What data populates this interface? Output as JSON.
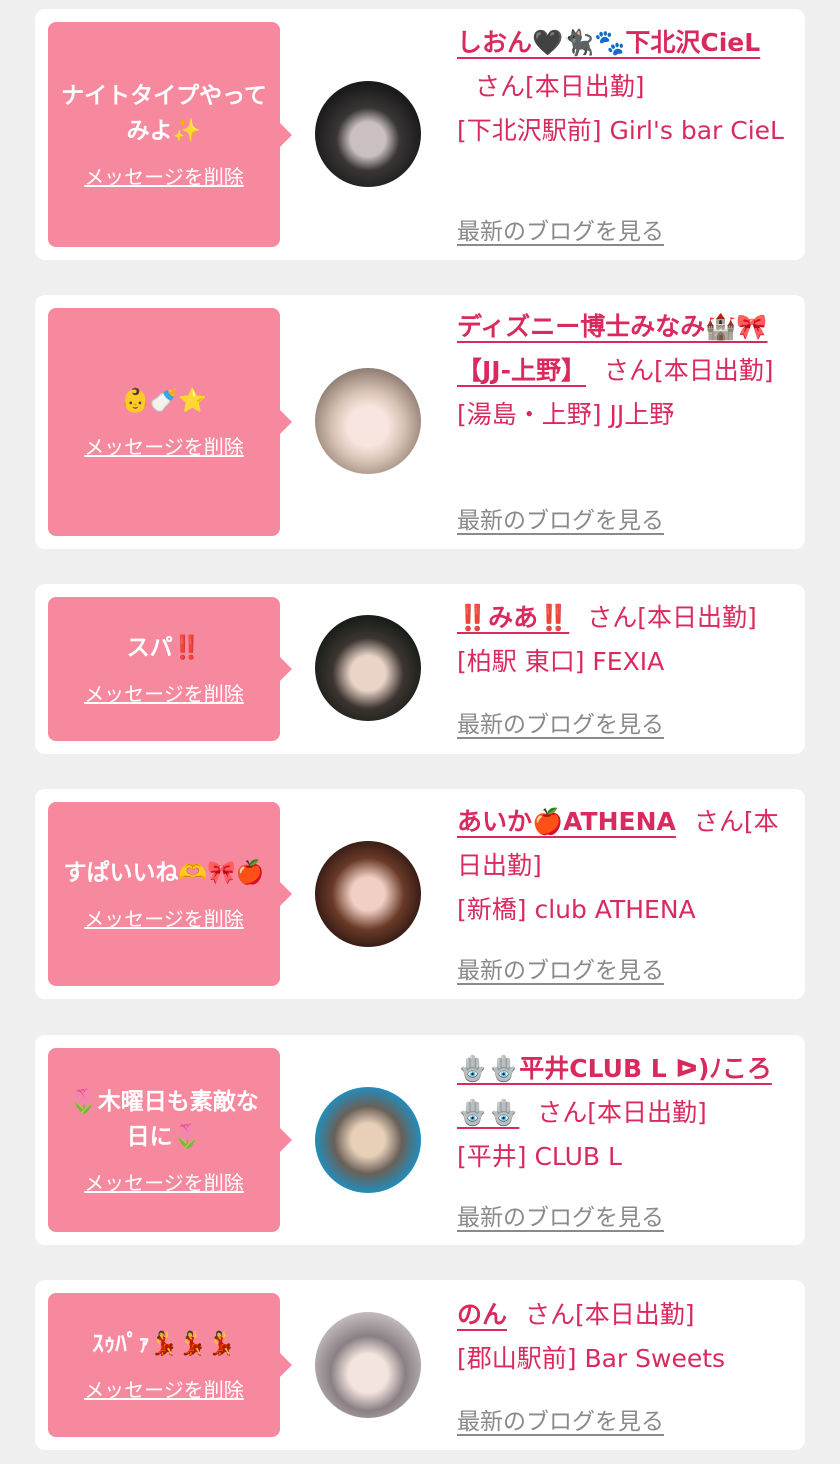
{
  "labels": {
    "delete": "メッセージを削除",
    "blog": "最新のブログを見る"
  },
  "items": [
    {
      "message": "ナイトタイプやってみよ✨",
      "name": "しおん🖤🐈‍⬛🐾下北沢CieL",
      "suffix": "さん[本日出勤]",
      "shop": "[下北沢駅前] Girl's bar CieL",
      "avatar_colors": [
        "#2a2a2a",
        "#a8a0a0"
      ]
    },
    {
      "message": "👶🍼⭐",
      "name": "ディズニー博士みなみ🏰🎀【JJ-上野】",
      "suffix": "さん[本日出勤]",
      "shop": "[湯島・上野] JJ上野",
      "avatar_colors": [
        "#f2ece6",
        "#c9a994"
      ]
    },
    {
      "message": "スパ‼️",
      "name": "‼️みあ‼️",
      "suffix": "さん[本日出勤]",
      "shop": "[柏駅 東口] FEXIA",
      "avatar_colors": [
        "#1e2a22",
        "#e8cfc2"
      ]
    },
    {
      "message": "すぱいいね🫶🎀🍎",
      "name": "あいか🍎ATHENA",
      "suffix": "さん[本日出勤]",
      "shop": "[新橋] club ATHENA",
      "avatar_colors": [
        "#5a2a1a",
        "#d99a7a"
      ]
    },
    {
      "message": "🌷木曜日も素敵な日に🌷",
      "name": "🪬🪬平井CLUB L ᐅ)ﾉころ🪬🪬",
      "suffix": "さん[本日出勤]",
      "shop": "[平井] CLUB L",
      "avatar_colors": [
        "#2aa8d8",
        "#d9c0a8"
      ]
    },
    {
      "message": "ｽｩﾊﾟｧ💃💃💃",
      "name": "のん",
      "suffix": "さん[本日出勤]",
      "shop": "[郡山駅前] Bar Sweets",
      "avatar_colors": [
        "#b8b0b4",
        "#efe3e0"
      ]
    }
  ]
}
